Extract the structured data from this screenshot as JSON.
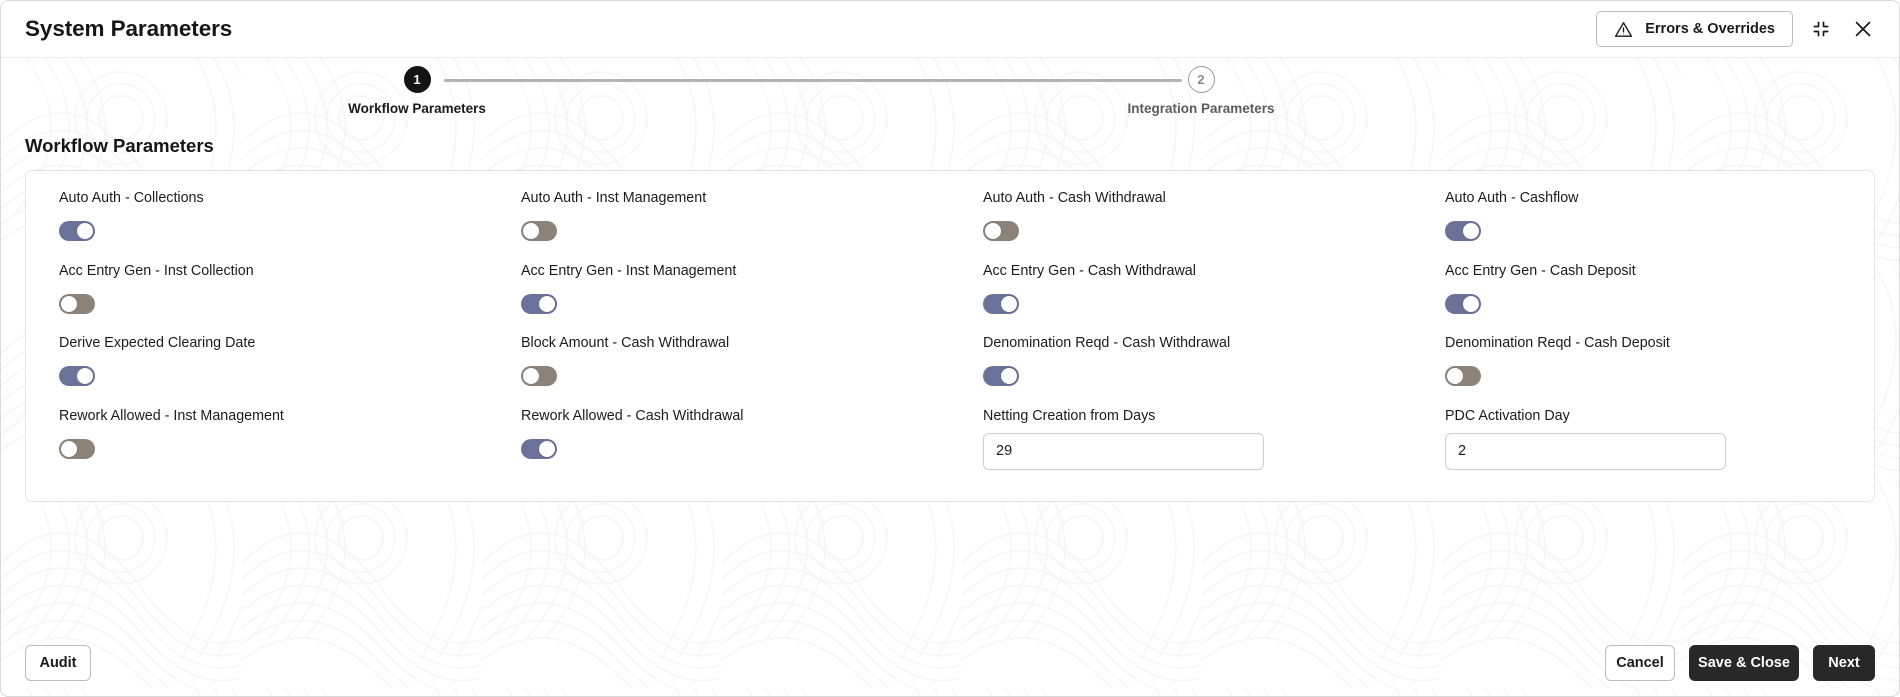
{
  "header": {
    "title": "System Parameters",
    "errors_button": "Errors & Overrides",
    "warning_icon": "warning-triangle-icon",
    "minimize_icon": "collapse-icon",
    "close_icon": "close-icon"
  },
  "stepper": {
    "steps": [
      {
        "number": "1",
        "label": "Workflow Parameters",
        "state": "active"
      },
      {
        "number": "2",
        "label": "Integration Parameters",
        "state": "inactive"
      }
    ]
  },
  "section": {
    "title": "Workflow Parameters"
  },
  "fields": [
    {
      "label": "Auto Auth - Collections",
      "type": "toggle",
      "value": "on"
    },
    {
      "label": "Auto Auth - Inst Management",
      "type": "toggle",
      "value": "off"
    },
    {
      "label": "Auto Auth - Cash Withdrawal",
      "type": "toggle",
      "value": "off"
    },
    {
      "label": "Auto Auth - Cashflow",
      "type": "toggle",
      "value": "on"
    },
    {
      "label": "Acc Entry Gen - Inst Collection",
      "type": "toggle",
      "value": "off"
    },
    {
      "label": "Acc Entry Gen - Inst Management",
      "type": "toggle",
      "value": "on"
    },
    {
      "label": "Acc Entry Gen - Cash Withdrawal",
      "type": "toggle",
      "value": "on"
    },
    {
      "label": "Acc Entry Gen - Cash Deposit",
      "type": "toggle",
      "value": "on"
    },
    {
      "label": "Derive Expected Clearing Date",
      "type": "toggle",
      "value": "on"
    },
    {
      "label": "Block Amount - Cash Withdrawal",
      "type": "toggle",
      "value": "off"
    },
    {
      "label": "Denomination Reqd - Cash Withdrawal",
      "type": "toggle",
      "value": "on"
    },
    {
      "label": "Denomination Reqd - Cash Deposit",
      "type": "toggle",
      "value": "off"
    },
    {
      "label": "Rework Allowed - Inst Management",
      "type": "toggle",
      "value": "off"
    },
    {
      "label": "Rework Allowed - Cash Withdrawal",
      "type": "toggle",
      "value": "on"
    },
    {
      "label": "Netting Creation from Days",
      "type": "text",
      "value": "29"
    },
    {
      "label": "PDC Activation Day",
      "type": "text",
      "value": "2"
    }
  ],
  "footer": {
    "audit": "Audit",
    "cancel": "Cancel",
    "save_close": "Save & Close",
    "next": "Next"
  },
  "colors": {
    "toggle_on": "#6a7299",
    "toggle_off": "#8b8379",
    "dark_button": "#282828",
    "step_active": "#141414"
  }
}
